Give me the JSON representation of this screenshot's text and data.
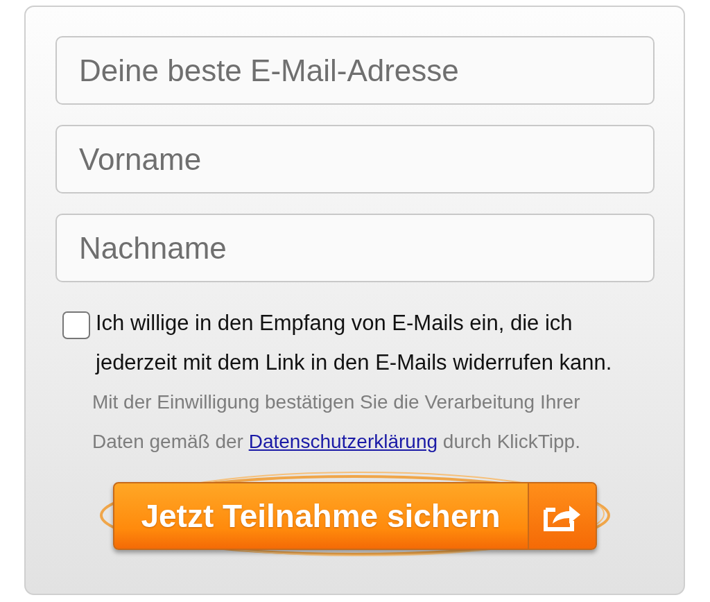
{
  "fields": [
    {
      "placeholder": "Deine beste E-Mail-Adresse"
    },
    {
      "placeholder": "Vorname"
    },
    {
      "placeholder": "Nachname"
    }
  ],
  "consent": {
    "checked": false,
    "text": "Ich willige in den Empfang von E-Mails ein, die ich jederzeit mit dem Link in den E-Mails widerrufen kann."
  },
  "notice": {
    "before": "Mit der Einwilligung bestätigen Sie die Verarbeitung Ihrer Daten gemäß der",
    "link": "Datenschutzerklärung",
    "after": "durch KlickTipp."
  },
  "submit_button": {
    "label": "Jetzt Teilnahme sichern"
  }
}
